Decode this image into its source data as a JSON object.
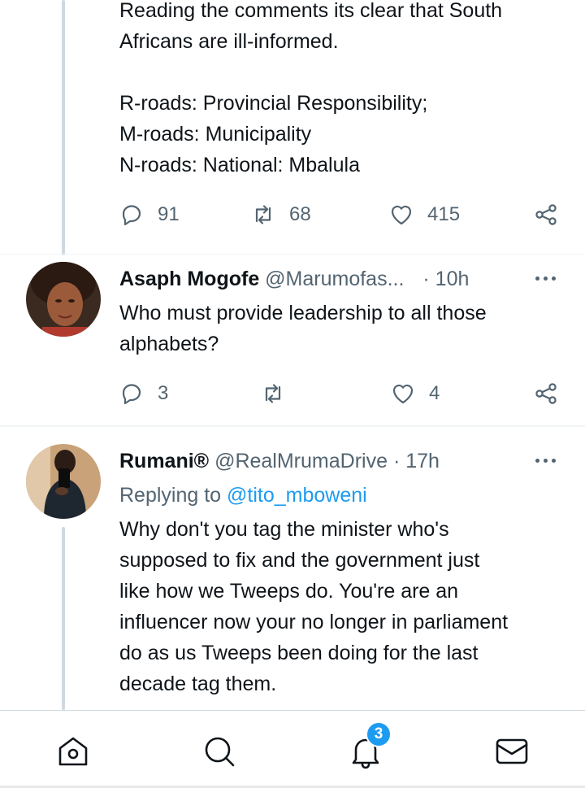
{
  "tweet1": {
    "text": "Reading the comments its clear that South\nAfricans are ill-informed.\n\nR-roads: Provincial Responsibility;\nM-roads: Municipality\nN-roads: National: Mbalula",
    "replies": "91",
    "retweets": "68",
    "likes": "415"
  },
  "tweet2": {
    "name": "Asaph Mogofe",
    "handle": "@Marumofas...",
    "time": "· 10h",
    "text": "Who must provide leadership to all those\nalphabets?",
    "replies": "3",
    "retweets": "",
    "likes": "4"
  },
  "tweet3": {
    "name": "Rumani®",
    "handle": "@RealMrumaDrive",
    "time": "· 17h",
    "replying_prefix": "Replying to ",
    "replying_to": "@tito_mboweni",
    "text": "Why don't you tag the minister who's\nsupposed to fix and the government just\nlike how we Tweeps do. You're are an\ninfluencer now your no longer in parliament\ndo as us Tweeps been doing for the last\ndecade tag them."
  },
  "nav": {
    "home": "home-icon",
    "search": "search-icon",
    "notifications": "bell-icon",
    "messages": "mail-icon",
    "notification_count": "3"
  },
  "colors": {
    "accent": "#1d9bf0",
    "muted": "#536471",
    "text": "#0f1419",
    "thread_line": "#cfd9de"
  }
}
